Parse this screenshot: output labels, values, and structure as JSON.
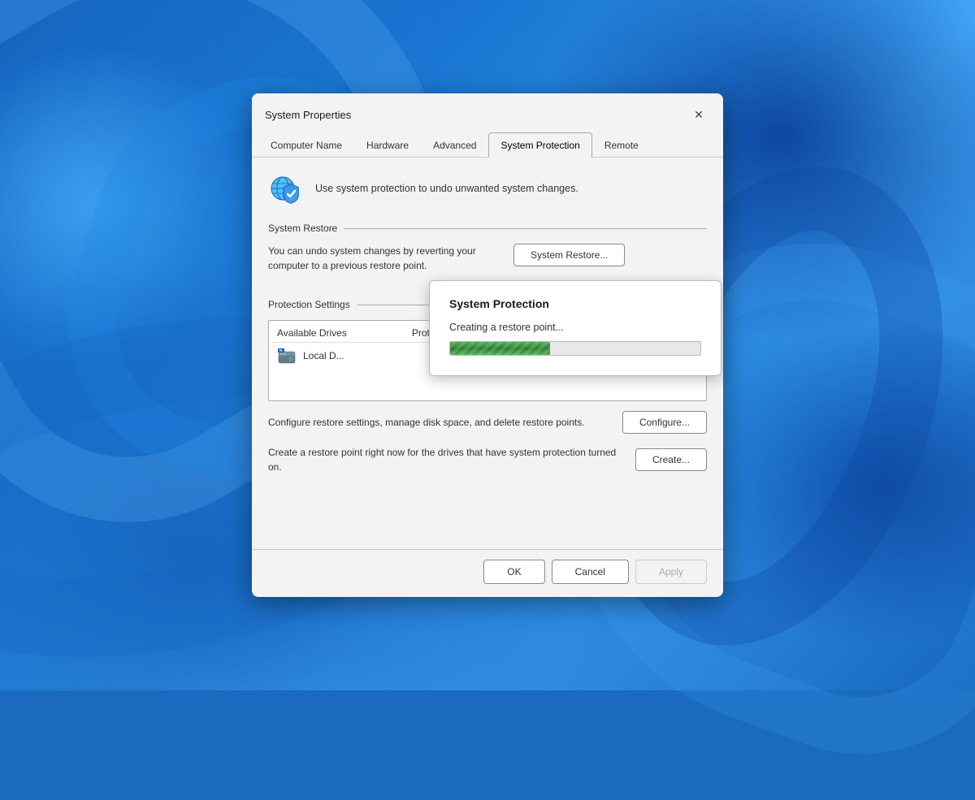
{
  "wallpaper": {
    "alt": "Windows 11 blue swirl wallpaper"
  },
  "dialog": {
    "title": "System Properties",
    "close_label": "✕",
    "tabs": [
      {
        "id": "computer-name",
        "label": "Computer Name",
        "active": false
      },
      {
        "id": "hardware",
        "label": "Hardware",
        "active": false
      },
      {
        "id": "advanced",
        "label": "Advanced",
        "active": false
      },
      {
        "id": "system-protection",
        "label": "System Protection",
        "active": true
      },
      {
        "id": "remote",
        "label": "Remote",
        "active": false
      }
    ],
    "intro_text": "Use system protection to undo unwanted system changes.",
    "system_restore": {
      "section_label": "System Restore",
      "description": "You can undo system changes by reverting your computer to a previous restore point.",
      "button_label": "System Restore..."
    },
    "protection_settings": {
      "section_label": "Protection Settings",
      "columns": [
        "Available Drives",
        "Protection"
      ],
      "drives": [
        {
          "name": "Local D...",
          "protection": ""
        }
      ],
      "configure_text": "Configure restore settings, manage disk space, and delete restore points.",
      "configure_button": "Configure...",
      "create_text": "Create a restore point right now for the drives that have system protection turned on.",
      "create_button": "Create..."
    },
    "footer": {
      "ok_label": "OK",
      "cancel_label": "Cancel",
      "apply_label": "Apply"
    }
  },
  "progress_dialog": {
    "title": "System Protection",
    "message": "Creating a restore point...",
    "progress_percent": 40
  }
}
